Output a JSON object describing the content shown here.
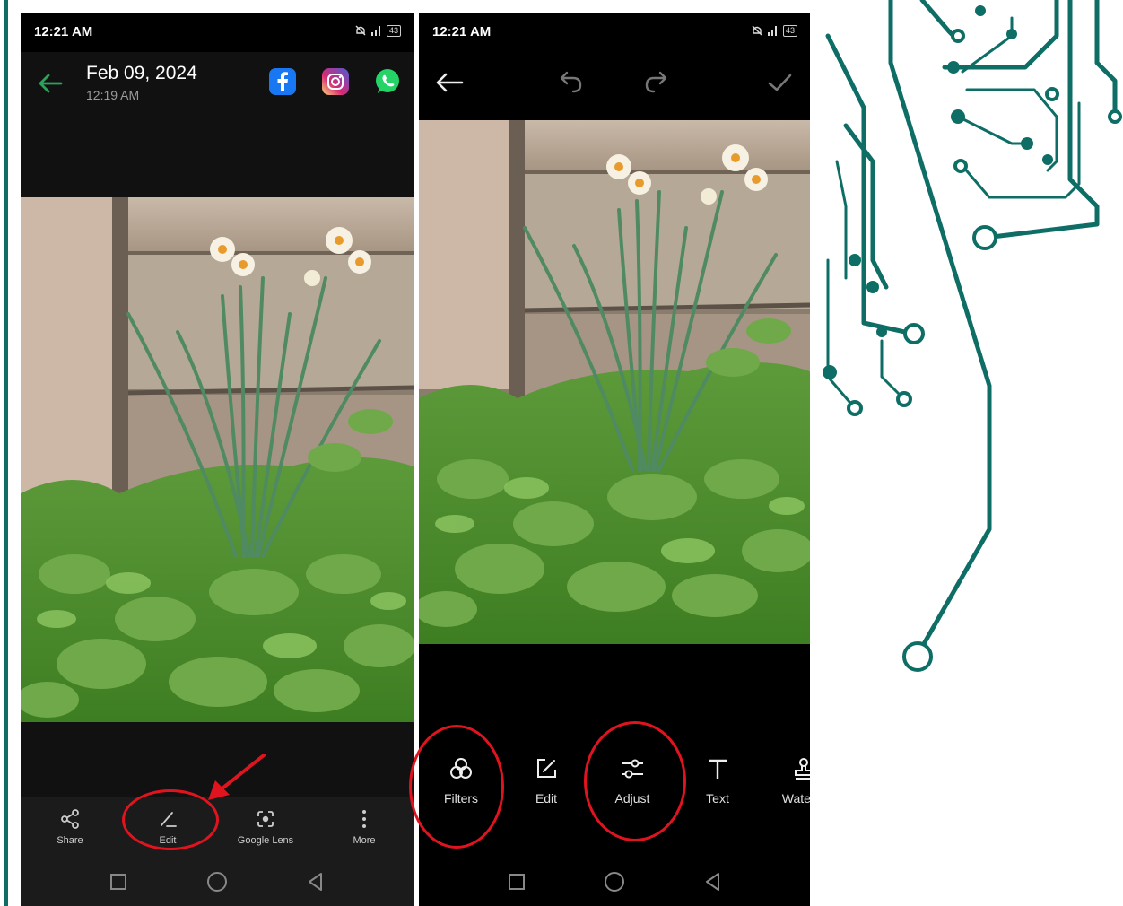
{
  "left_screen": {
    "status": {
      "time": "12:21 AM",
      "battery": "43"
    },
    "header": {
      "date": "Feb 09, 2024",
      "time": "12:19 AM"
    },
    "share_icons": [
      "facebook-icon",
      "instagram-icon",
      "whatsapp-icon"
    ],
    "toolbar": [
      {
        "label": "Share",
        "icon": "share-icon"
      },
      {
        "label": "Edit",
        "icon": "edit-pen-icon"
      },
      {
        "label": "Google Lens",
        "icon": "google-lens-icon"
      },
      {
        "label": "More",
        "icon": "more-vertical-icon"
      }
    ]
  },
  "right_screen": {
    "status": {
      "time": "12:21 AM",
      "battery": "43"
    },
    "top_actions": [
      "back-arrow-icon",
      "undo-icon",
      "redo-icon",
      "confirm-check-icon"
    ],
    "tools": [
      {
        "label": "Filters",
        "icon": "filters-icon"
      },
      {
        "label": "Edit",
        "icon": "edit-box-icon"
      },
      {
        "label": "Adjust",
        "icon": "adjust-sliders-icon"
      },
      {
        "label": "Text",
        "icon": "text-icon"
      },
      {
        "label": "Waterm",
        "icon": "watermark-stamp-icon"
      }
    ]
  },
  "colors": {
    "accent_green": "#2ea05c",
    "annotation_red": "#e0141f",
    "circuit_teal": "#0e6e66"
  }
}
